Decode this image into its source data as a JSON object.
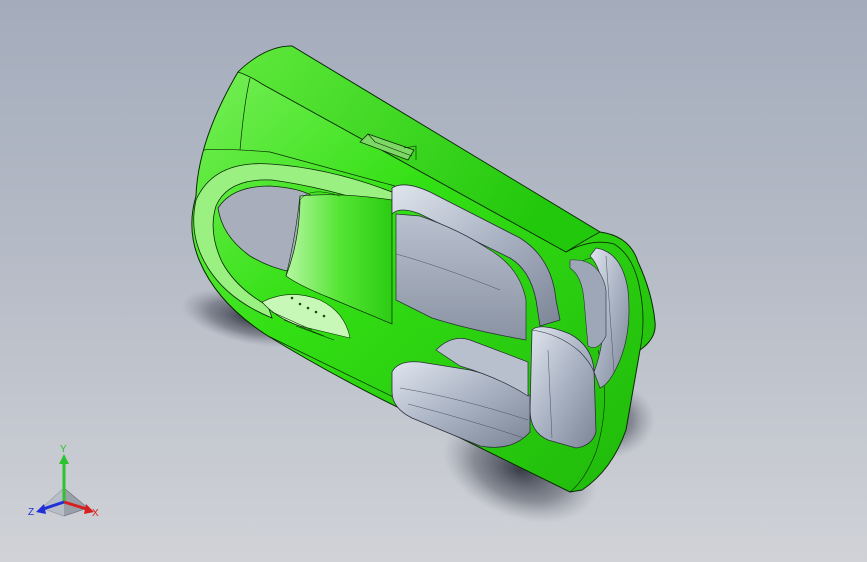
{
  "viewport": {
    "background_top": "#a4acbc",
    "background_bottom": "#d0d2d7"
  },
  "model": {
    "body_color": "#33e014",
    "body_dark": "#1fb80a",
    "body_light": "#8ff57a",
    "insert_color": "#aab3c3",
    "insert_light": "#d4dbe6",
    "insert_dark": "#7c8596",
    "edge_color": "#0a2a05"
  },
  "triad": {
    "y_label": "Y",
    "x_label": "X",
    "z_label": "Z",
    "y_color": "#2ec22e",
    "x_color": "#d62020",
    "z_color": "#2030d8"
  }
}
